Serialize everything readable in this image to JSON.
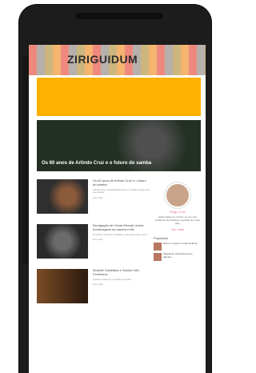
{
  "banner": {
    "logo_text": "ZIRIGUIDUM"
  },
  "hero": {
    "caption": "Os 60 anos de Arlindo Cruz e o futuro do samba"
  },
  "articles": [
    {
      "headline": "Os 60 anos de Arlindo Cruz e o futuro do samba",
      "excerpt": "Arlindo Cruz completa 60 anos e o samba segue com sua marca…",
      "date": "Há 2 dias"
    },
    {
      "headline": "Divulgação de César Menotti revela homenagens ao samba e fãs",
      "excerpt": "O cantor comenta novidades e projetos para o ano.",
      "date": "Há 4 dias"
    },
    {
      "headline": "Moselle Sandálias e Samba São Femininos",
      "excerpt": "Leitura e cultura: um roteiro musical.",
      "date": "Há 6 dias"
    }
  ],
  "sidebar": {
    "blogger_name": "Diogo Cruz",
    "bio": "Apaixonado por música, sou um dos curadores de histórias e sambas do nosso país.",
    "more_label": "Ver mais",
    "section_title": "Populares",
    "popular": [
      "Ritmo e poesia: a roda continua",
      "Ziriguidum entrevista novos talentos"
    ]
  },
  "colors": {
    "ad_orange": "#ffb100",
    "accent_pink": "#e86c9a"
  }
}
